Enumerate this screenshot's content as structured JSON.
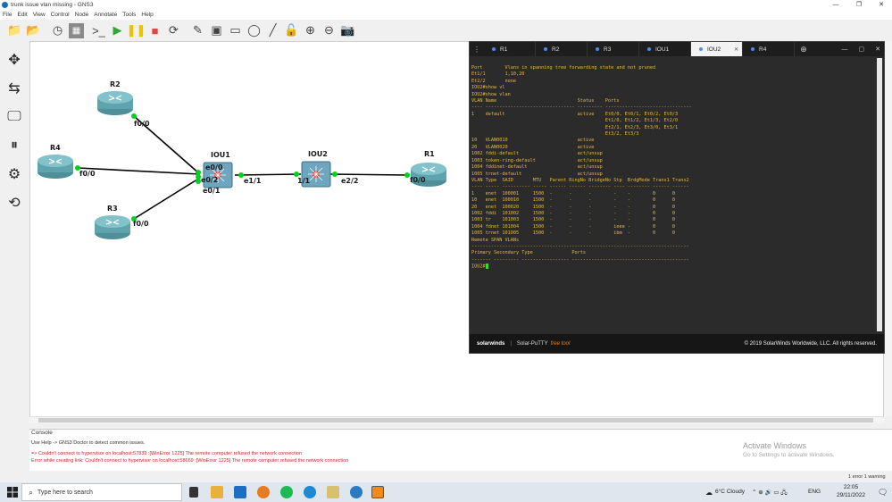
{
  "window": {
    "title": "trunk issue vlan missing - GNS3",
    "controls": [
      "—",
      "❐",
      "✕"
    ]
  },
  "menu": [
    "File",
    "Edit",
    "View",
    "Control",
    "Node",
    "Annotate",
    "Tools",
    "Help"
  ],
  "topology": {
    "nodes": [
      {
        "name": "R2",
        "type": "router"
      },
      {
        "name": "R4",
        "type": "router"
      },
      {
        "name": "R3",
        "type": "router"
      },
      {
        "name": "IOU1",
        "type": "switch"
      },
      {
        "name": "IOU2",
        "type": "switch"
      },
      {
        "name": "R1",
        "type": "router"
      }
    ],
    "interface_labels": {
      "r2_f00": "f0/0",
      "r4_f00": "f0/0",
      "r3_f00": "f0/0",
      "iou1_e00": "e0/0",
      "iou1_e02": "e0/2",
      "iou1_e01": "e0/1",
      "iou1_e11": "e1/1",
      "iou2_11": "1/1",
      "iou2_e22": "e2/2",
      "r1_f00": "f0/0"
    }
  },
  "terminal": {
    "tabs": [
      {
        "label": "R1",
        "active": false
      },
      {
        "label": "R2",
        "active": false
      },
      {
        "label": "R3",
        "active": false
      },
      {
        "label": "IOU1",
        "active": false
      },
      {
        "label": "IOU2",
        "active": true
      },
      {
        "label": "R4",
        "active": false
      }
    ],
    "lines": [
      "Port        Vlans in spanning tree forwarding state and not pruned",
      "Et1/1       1,10,20",
      "Et2/2       none",
      "IOU2#show vl",
      "IOU2#show vlan",
      "",
      "VLAN Name                             Status    Ports",
      "---- -------------------------------- --------- -------------------------------",
      "1    default                          active    Et0/0, Et0/1, Et0/2, Et0/3",
      "                                                Et1/0, Et1/2, Et1/3, Et2/0",
      "                                                Et2/1, Et2/3, Et3/0, Et3/1",
      "                                                Et3/2, Et3/3",
      "10   VLAN0010                         active",
      "20   VLAN0020                         active",
      "1002 fddi-default                     act/unsup",
      "1003 token-ring-default               act/unsup",
      "1004 fddinet-default                  act/unsup",
      "1005 trnet-default                    act/unsup",
      "",
      "VLAN Type  SAID       MTU   Parent RingNo BridgeNo Stp  BrdgMode Trans1 Trans2",
      "---- ----- ---------- ----- ------ ------ -------- ---- -------- ------ ------",
      "1    enet  100001     1500  -      -      -        -    -        0      0",
      "10   enet  100010     1500  -      -      -        -    -        0      0",
      "20   enet  100020     1500  -      -      -        -    -        0      0",
      "1002 fddi  101002     1500  -      -      -        -    -        0      0",
      "1003 tr    101003     1500  -      -      -        -    -        0      0",
      "1004 fdnet 101004     1500  -      -      -        ieee -        0      0",
      "1005 trnet 101005     1500  -      -      -        ibm  -        0      0",
      "",
      "Remote SPAN VLANs",
      "------------------------------------------------------------------------------",
      "",
      "",
      "Primary Secondary Type              Ports",
      "------- --------- ----------------- ------------------------------------------",
      "",
      ""
    ],
    "prompt": "IOU2#",
    "footer_brand": "solarwinds",
    "footer_product": "Solar-PuTTY",
    "footer_free": "free tool",
    "footer_copyright": "© 2019 SolarWinds Worldwide, LLC. All rights reserved."
  },
  "console": {
    "title": "Console",
    "lines": [
      {
        "text": "Use Help -> GNS3 Doctor to detect common issues.",
        "kind": "info"
      },
      {
        "text": "=> Couldn't connect to hypervisor on localhost:57839 :[WinError 1225] The remote computer refused the network connection",
        "kind": "error"
      },
      {
        "text": "Error while creating link: Couldn't connect to hypervisor on localhost:58669 :[WinError 1225] The remote computer refused the network connection",
        "kind": "error"
      }
    ],
    "error_count": "1 error 1 warning"
  },
  "watermark": {
    "title": "Activate Windows",
    "subtitle": "Go to Settings to activate Windows."
  },
  "taskbar": {
    "search_placeholder": "Type here to search",
    "weather": "6°C  Cloudy",
    "language": "ENG",
    "time": "22:05",
    "date": "29/11/2022"
  },
  "colors": {
    "terminal_text": "#e8b93a",
    "cursor": "#2ce02c",
    "link_dot": "#00d11c",
    "error_text": "#d31f1f",
    "tab_dot": "#4a8ff0"
  }
}
